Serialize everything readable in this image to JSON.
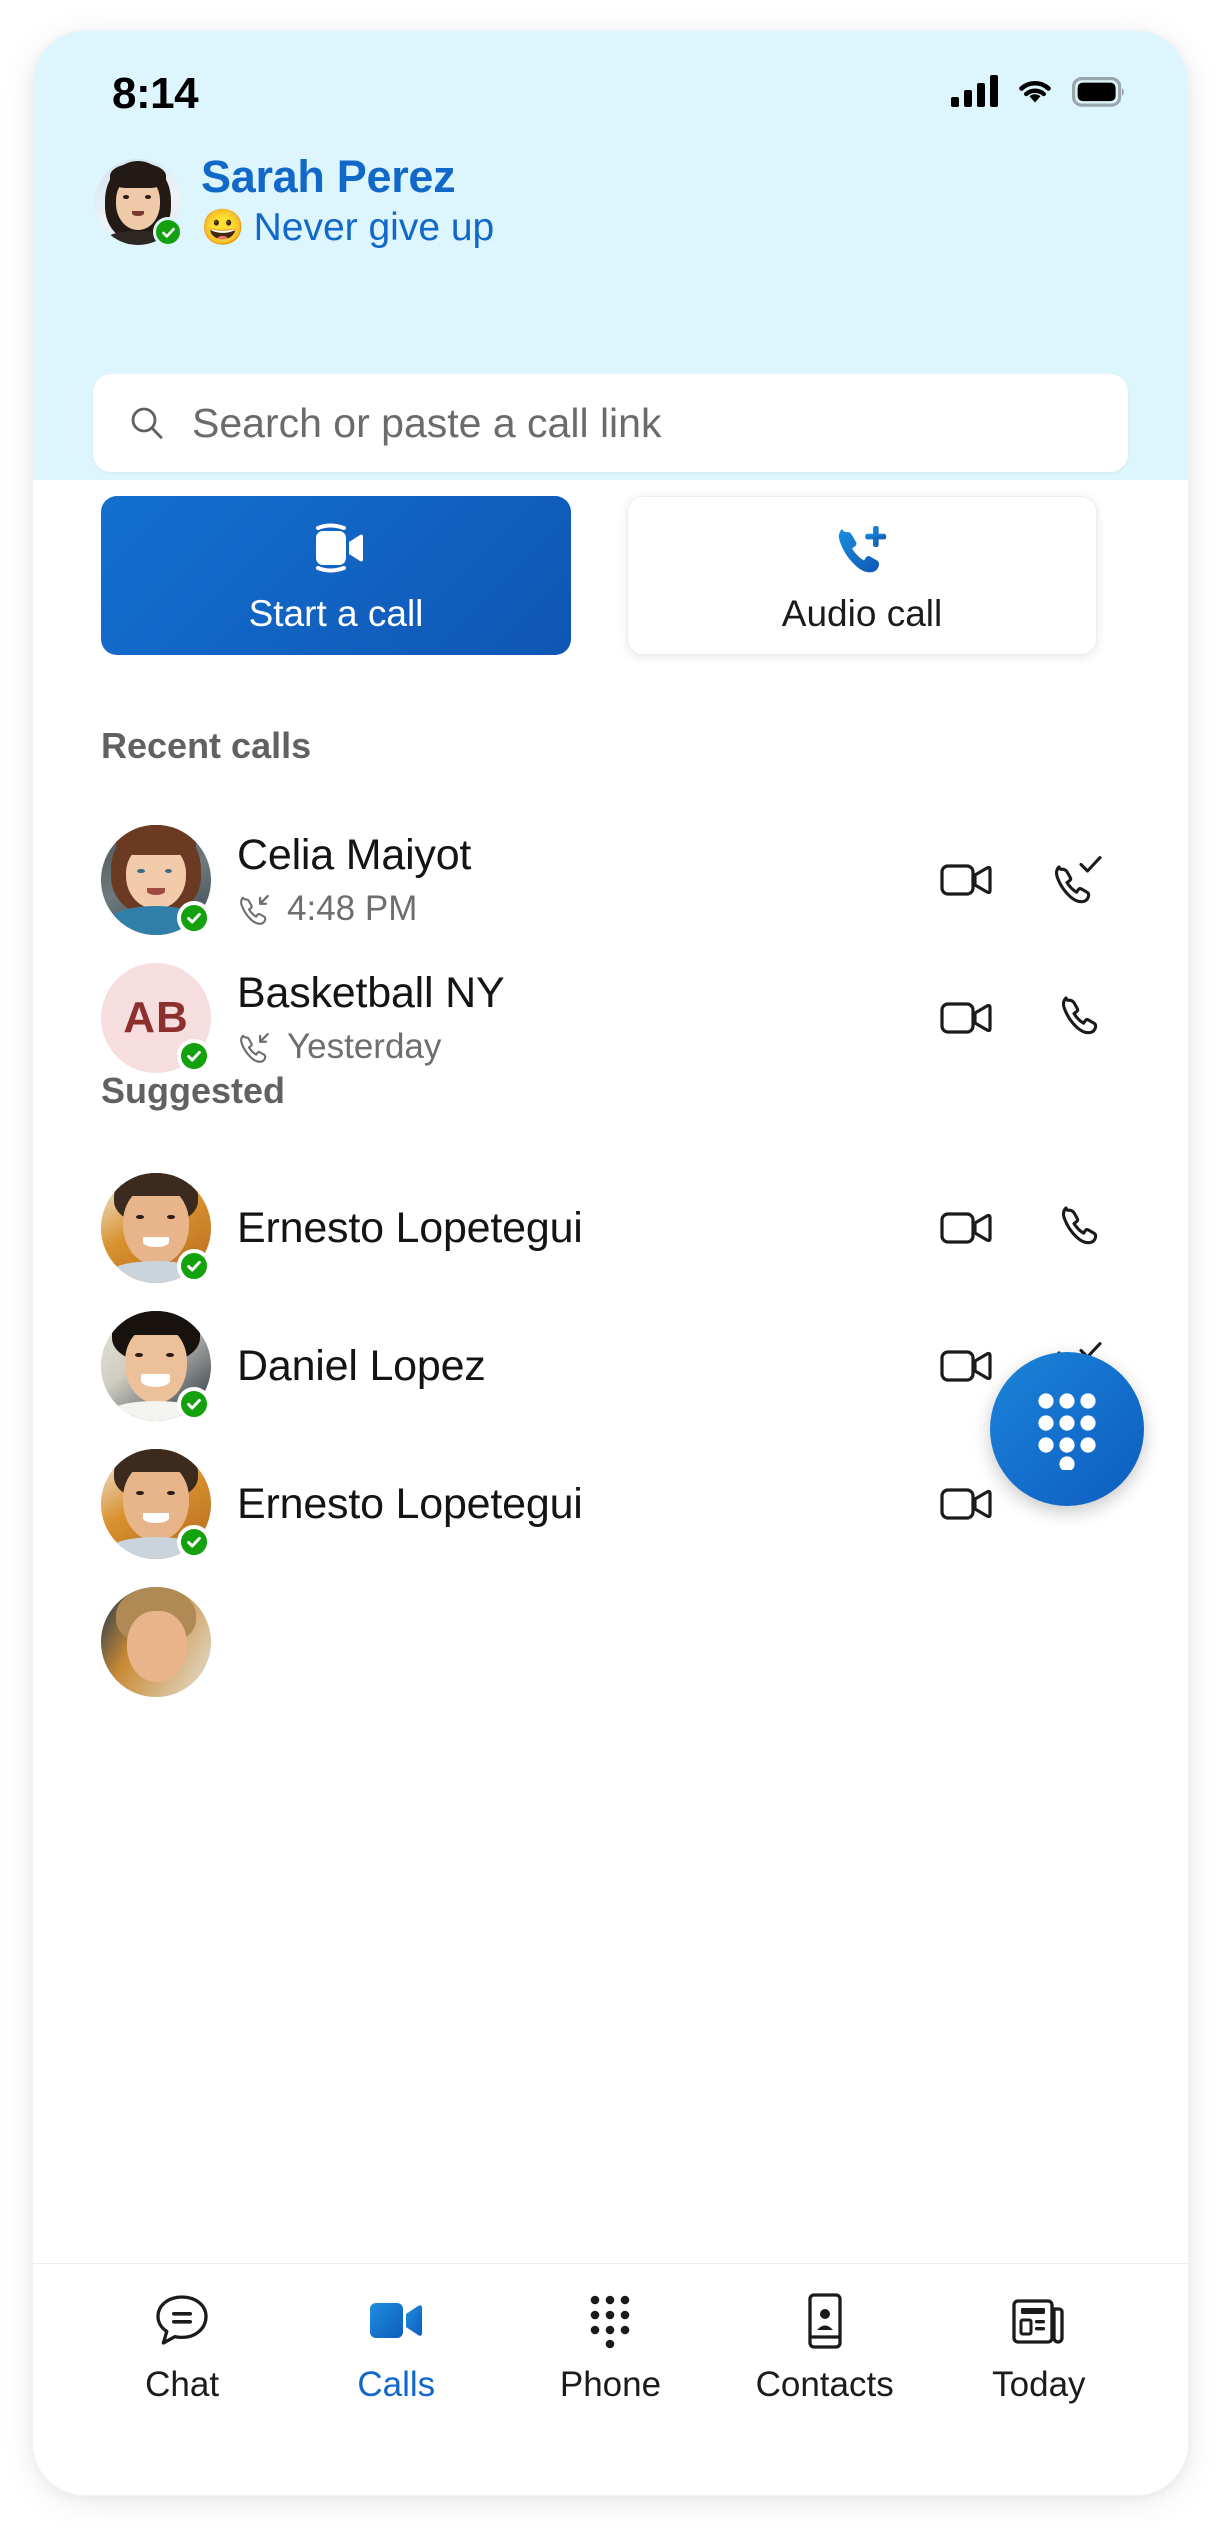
{
  "status_bar": {
    "time": "8:14",
    "icons": [
      "cellular-signal-icon",
      "wifi-icon",
      "battery-icon"
    ]
  },
  "header": {
    "profile_name": "Sarah Perez",
    "profile_mood_emoji": "😀",
    "profile_mood": "Never give up",
    "presence": "available",
    "avatar_name": "sarah-perez-avatar",
    "accent_color": "#1168c9",
    "background_color": "#ddf6fd"
  },
  "search": {
    "placeholder": "Search or paste a call link",
    "icon": "search-icon"
  },
  "quick_actions": [
    {
      "label": "Start a call",
      "icon": "video-camera-icon",
      "style": "primary"
    },
    {
      "label": "Audio call",
      "icon": "phone-plus-icon",
      "style": "secondary"
    }
  ],
  "sections": [
    {
      "title": "Recent calls",
      "items": [
        {
          "name": "Celia Maiyot",
          "meta_icon": "incoming-call-icon",
          "meta": "4:48 PM",
          "presence": "available",
          "avatar_type": "photo",
          "actions": [
            "video-call-icon",
            "phone-check-icon"
          ]
        },
        {
          "name": "Basketball NY",
          "meta_icon": "incoming-call-icon",
          "meta": "Yesterday",
          "presence": "available",
          "avatar_type": "initials",
          "initials": "AB",
          "avatar_bg": "#f6dede",
          "avatar_fg": "#8e2f2f",
          "actions": [
            "video-call-icon",
            "phone-icon"
          ]
        }
      ]
    },
    {
      "title": "Suggested",
      "items": [
        {
          "name": "Ernesto Lopetegui",
          "meta": "",
          "presence": "available",
          "avatar_type": "photo",
          "actions": [
            "video-call-icon",
            "phone-icon"
          ]
        },
        {
          "name": "Daniel Lopez",
          "meta": "",
          "presence": "available",
          "avatar_type": "photo",
          "actions": [
            "video-call-icon",
            "phone-check-icon"
          ]
        },
        {
          "name": "Ernesto Lopetegui",
          "meta": "",
          "presence": "available",
          "avatar_type": "photo",
          "actions": [
            "video-call-icon"
          ]
        }
      ]
    }
  ],
  "fab": {
    "icon": "dialpad-icon",
    "color": "#1470cd"
  },
  "bottom_nav": {
    "active": "Calls",
    "items": [
      {
        "label": "Chat",
        "icon": "chat-bubble-icon"
      },
      {
        "label": "Calls",
        "icon": "video-camera-filled-icon"
      },
      {
        "label": "Phone",
        "icon": "dialpad-icon"
      },
      {
        "label": "Contacts",
        "icon": "contact-card-icon"
      },
      {
        "label": "Today",
        "icon": "newspaper-icon"
      }
    ]
  }
}
